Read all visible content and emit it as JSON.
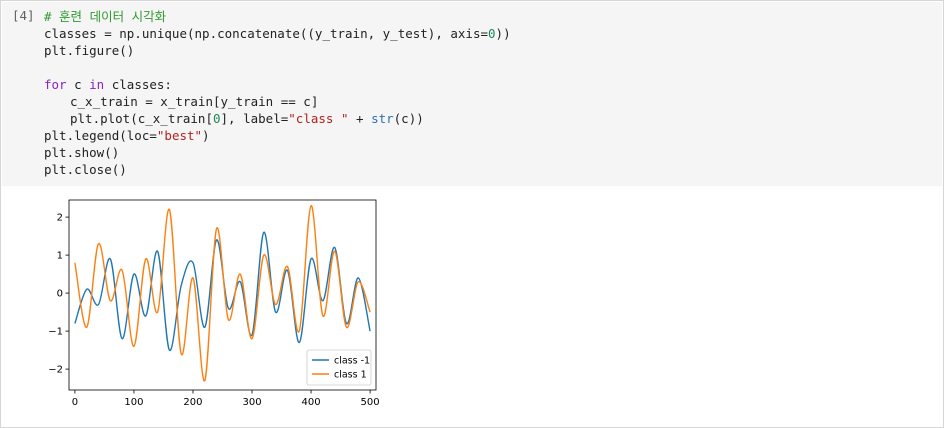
{
  "cell": {
    "prompt": "[4]",
    "code": {
      "comment": "# 훈련 데이터 시각화",
      "l2a": "classes = np.unique(np.concatenate((y_train, y_test), axis=",
      "l2num": "0",
      "l2b": "))",
      "l3": "plt.figure()",
      "l5kw1": "for",
      "l5a": " c ",
      "l5kw2": "in",
      "l5b": " classes:",
      "l6": "c_x_train = x_train[y_train == c]",
      "l7a": "plt.plot(c_x_train[",
      "l7num": "0",
      "l7b": "], label=",
      "l7str": "\"class \"",
      "l7c": " + ",
      "l7bi": "str",
      "l7d": "(c))",
      "l8a": "plt.legend(loc=",
      "l8str": "\"best\"",
      "l8b": ")",
      "l9": "plt.show()",
      "l10": "plt.close()"
    }
  },
  "chart_data": {
    "type": "line",
    "xlim": [
      -10,
      510
    ],
    "ylim": [
      -2.55,
      2.45
    ],
    "x_ticks": [
      "0",
      "100",
      "200",
      "300",
      "400",
      "500"
    ],
    "y_ticks": [
      "-2",
      "-1",
      "0",
      "1",
      "2"
    ],
    "grid": false,
    "legend_position": "bottom-right",
    "x_step": 20,
    "series": [
      {
        "name": "class -1",
        "color": "#1f77b4",
        "values": [
          -0.8,
          0.1,
          -0.3,
          0.9,
          -1.2,
          0.5,
          -0.6,
          1.1,
          -1.5,
          0.2,
          0.8,
          -0.9,
          1.4,
          -0.4,
          0.3,
          -1.1,
          1.6,
          -0.5,
          0.6,
          -1.3,
          0.9,
          -0.2,
          1.2,
          -0.8,
          0.4,
          -1.0
        ]
      },
      {
        "name": "class 1",
        "color": "#ff7f0e",
        "values": [
          0.8,
          -0.9,
          1.3,
          -0.2,
          0.6,
          -1.4,
          0.9,
          -0.5,
          2.2,
          -1.6,
          0.4,
          -2.3,
          1.7,
          -0.7,
          0.5,
          -1.2,
          1.0,
          -0.3,
          0.7,
          -1.0,
          2.3,
          -0.6,
          1.1,
          -0.9,
          0.3,
          -0.5
        ]
      }
    ]
  }
}
